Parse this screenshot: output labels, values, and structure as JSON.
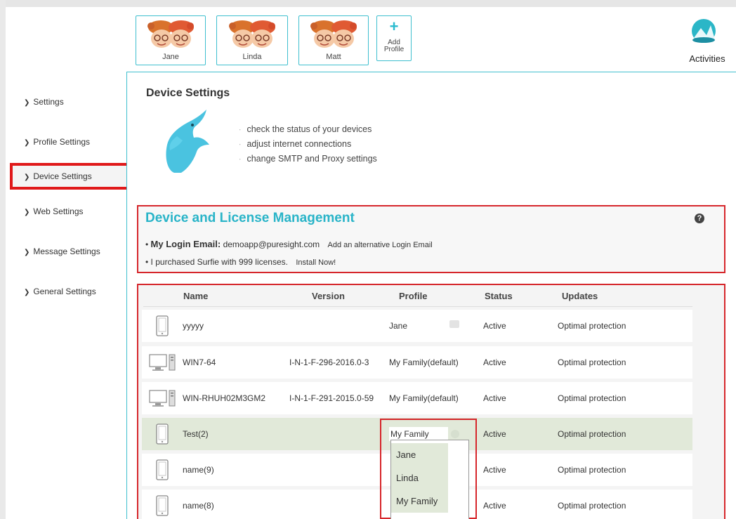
{
  "profiles": [
    {
      "name": "Jane"
    },
    {
      "name": "Linda"
    },
    {
      "name": "Matt"
    }
  ],
  "add_profile": {
    "line1": "Add",
    "line2": "Profile"
  },
  "activities": {
    "label": "Activities",
    "icon": "activities-icon"
  },
  "sidebar": {
    "items": [
      {
        "label": "Settings"
      },
      {
        "label": "Profile Settings"
      },
      {
        "label": "Device Settings",
        "active": true
      },
      {
        "label": "Web Settings"
      },
      {
        "label": "Message Settings"
      },
      {
        "label": "General Settings"
      }
    ]
  },
  "page": {
    "title": "Device Settings",
    "bullets": [
      "check the status of your devices",
      "adjust internet connections",
      "change SMTP and Proxy settings"
    ]
  },
  "management": {
    "title": "Device and License Management",
    "help": "?",
    "login_label": "My Login Email:",
    "login_email": "demoapp@puresight.com",
    "alt_login_link": "Add an alternative Login Email",
    "license_text": "I purchased Surfie with 999 licenses.",
    "install_link": "Install Now!"
  },
  "table": {
    "headers": {
      "name": "Name",
      "version": "Version",
      "profile": "Profile",
      "status": "Status",
      "updates": "Updates"
    },
    "rows": [
      {
        "device": "mobile",
        "name": "yyyyy",
        "version": "",
        "profile": "Jane",
        "status": "Active",
        "updates": "Optimal protection"
      },
      {
        "device": "desktop",
        "name": "WIN7-64",
        "version": "I-N-1-F-296-2016.0-3",
        "profile": "My Family(default)",
        "status": "Active",
        "updates": "Optimal protection"
      },
      {
        "device": "desktop",
        "name": "WIN-RHUH02M3GM2",
        "version": "I-N-1-F-291-2015.0-59",
        "profile": "My Family(default)",
        "status": "Active",
        "updates": "Optimal protection"
      },
      {
        "device": "mobile",
        "name": "Test(2)",
        "version": "",
        "profile": "My Family",
        "status": "Active",
        "updates": "Optimal protection"
      },
      {
        "device": "mobile",
        "name": "name(9)",
        "version": "",
        "profile": "",
        "status": "Active",
        "updates": "Optimal protection"
      },
      {
        "device": "mobile",
        "name": "name(8)",
        "version": "",
        "profile": "",
        "status": "Active",
        "updates": "Optimal protection"
      }
    ],
    "dropdown_options": [
      "Jane",
      "Linda",
      "My Family"
    ]
  },
  "colors": {
    "accent": "#29b4c8",
    "highlight": "#d6262b",
    "selected_row": "#e1e9d9"
  }
}
